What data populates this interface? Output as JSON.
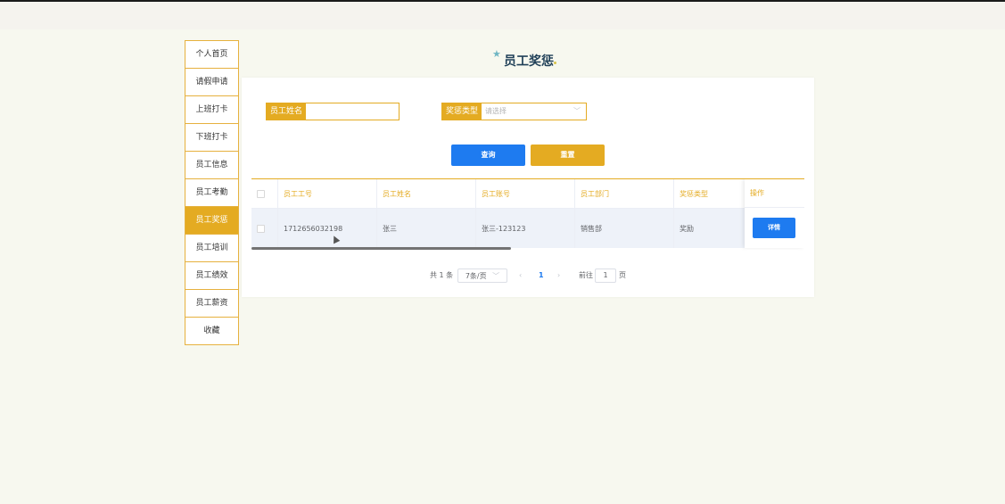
{
  "sidebar": {
    "items": [
      {
        "label": "个人首页",
        "active": false
      },
      {
        "label": "请假申请",
        "active": false
      },
      {
        "label": "上班打卡",
        "active": false
      },
      {
        "label": "下班打卡",
        "active": false
      },
      {
        "label": "员工信息",
        "active": false
      },
      {
        "label": "员工考勤",
        "active": false
      },
      {
        "label": "员工奖惩",
        "active": true
      },
      {
        "label": "员工培训",
        "active": false
      },
      {
        "label": "员工绩效",
        "active": false
      },
      {
        "label": "员工薪资",
        "active": false
      },
      {
        "label": "收藏",
        "active": false
      }
    ]
  },
  "page": {
    "title": "员工奖惩"
  },
  "search": {
    "name_label": "员工姓名",
    "name_value": "",
    "type_label": "奖惩类型",
    "type_placeholder": "请选择",
    "query_button": "查询",
    "reset_button": "重置"
  },
  "table": {
    "columns": [
      "员工工号",
      "员工姓名",
      "员工账号",
      "员工部门",
      "奖惩类型",
      "操作"
    ],
    "rows": [
      {
        "emp_no": "1712656032198",
        "emp_name": "张三",
        "account": "张三-123123",
        "dept": "销售部",
        "type": "奖励",
        "action": "详情"
      }
    ]
  },
  "pagination": {
    "total_text": "共 1 条",
    "page_size": "7条/页",
    "current_page": "1",
    "goto_label": "前往",
    "goto_value": "1",
    "page_suffix": "页"
  },
  "colors": {
    "accent": "#e4ab22",
    "primary": "#1e7bf0",
    "background": "#f7f8ef"
  }
}
